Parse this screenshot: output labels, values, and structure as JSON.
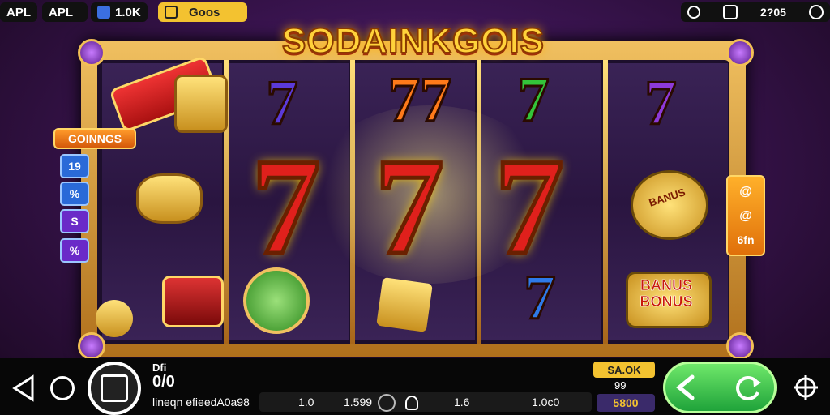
{
  "status_bar": {
    "label_1": "APL",
    "label_2": "APL",
    "coins_badge": "1.0K",
    "gold_badge": "Goos",
    "time": "2?05",
    "icons": [
      "search-icon",
      "stop-icon",
      "wifi-icon",
      "close-icon"
    ]
  },
  "game": {
    "title": "SODAINKGOIS",
    "left_panel": {
      "header": "GOINNGS",
      "buttons": [
        "19",
        "%",
        "S",
        "%"
      ]
    },
    "right_panel": {
      "buttons": [
        "@",
        "@",
        "6fn"
      ]
    },
    "reels": {
      "top_row": [
        "7",
        "77",
        "7",
        "7"
      ],
      "middle_row": [
        "7",
        "7",
        "7"
      ],
      "bonus_label_1": "BANUS",
      "bonus_label_2": "BONUS",
      "reel_stamp": "BANUS"
    }
  },
  "bottom_bar": {
    "bet_label": "Dfi",
    "bet_value": "0/0",
    "info_text": "lineqn efieedA0a98",
    "stat_1": "1.0",
    "stat_2": "1.599",
    "stat_3": "1.6",
    "stat_4": "1.0c0",
    "win_badge": "SA.OK",
    "win_count": "99",
    "credit_badge": "5800",
    "icons": [
      "back-icon",
      "power-icon",
      "stop-icon",
      "camera-icon",
      "left-arrow-icon",
      "refresh-icon",
      "crosshair-icon"
    ]
  },
  "colors": {
    "accent_gold": "#f3c230",
    "spin_green": "#2fc64a",
    "reel_red": "#e0201c",
    "panel_orange": "#f39a1a",
    "panel_purple": "#5a2aa8"
  }
}
